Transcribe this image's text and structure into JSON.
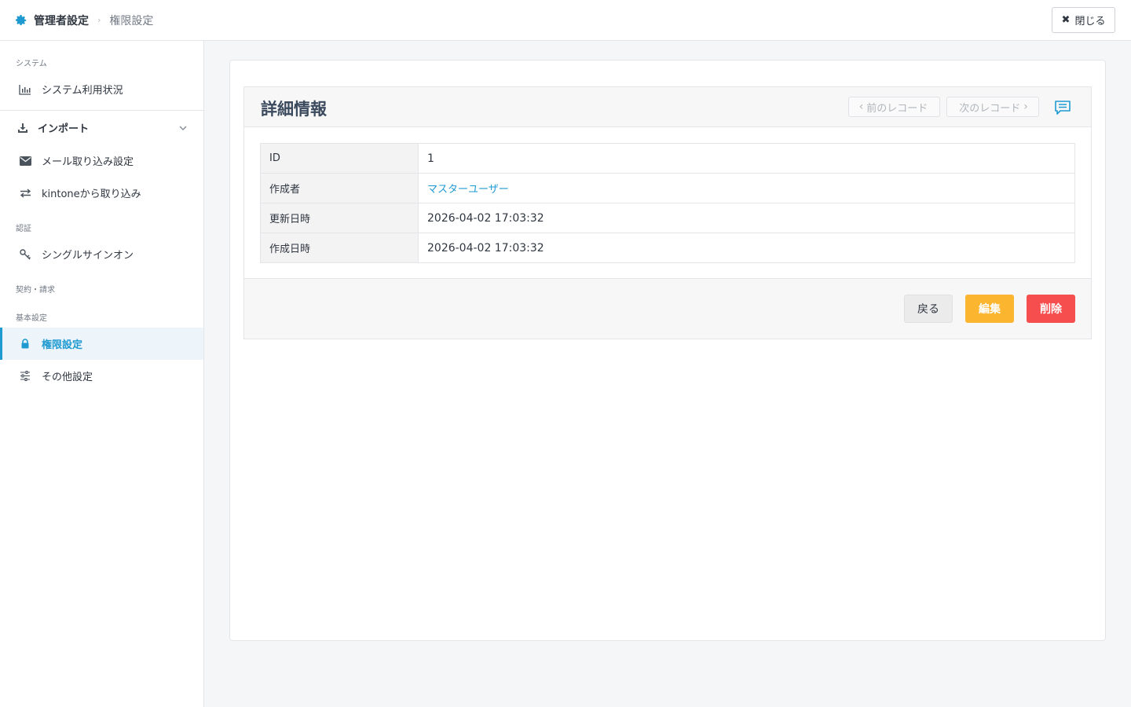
{
  "header": {
    "root_label": "管理者設定",
    "current_label": "権限設定",
    "close_label": "閉じる"
  },
  "sidebar": {
    "sections": {
      "system": "システム",
      "auth": "認証",
      "contract": "契約・請求",
      "basic": "基本設定"
    },
    "items": {
      "usage": "システム利用状況",
      "import": "インポート",
      "mail_import": "メール取り込み設定",
      "kintone_import": "kintoneから取り込み",
      "sso": "シングルサインオン",
      "permissions": "権限設定",
      "other": "その他設定"
    },
    "active_color": "#1f9ad1"
  },
  "panel": {
    "title": "詳細情報",
    "prev_label": "前のレコード",
    "next_label": "次のレコード",
    "rows": [
      {
        "key": "ID",
        "value": "1"
      },
      {
        "key": "作成者",
        "value": "マスターユーザー"
      },
      {
        "key": "更新日時",
        "value": "2026-04-02 17:03:32"
      },
      {
        "key": "作成日時",
        "value": "2026-04-02 17:03:32"
      }
    ],
    "back_label": "戻る",
    "edit_label": "編集",
    "delete_label": "削除",
    "edit_color": "#fbb52f",
    "delete_color": "#f64e4e"
  }
}
